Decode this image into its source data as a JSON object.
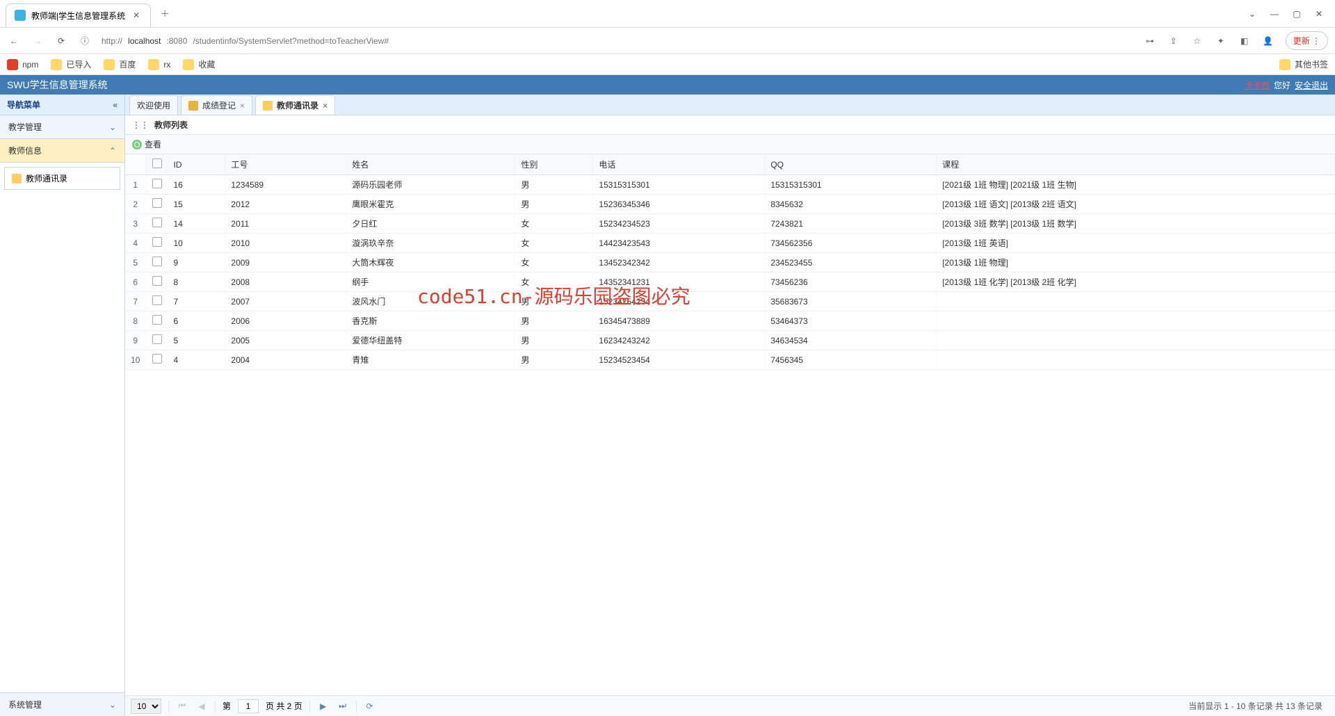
{
  "browser": {
    "tab_title": "教师端|学生信息管理系统",
    "url_prefix": "http://",
    "url_host": "localhost",
    "url_port": ":8080",
    "url_path": "/studentinfo/SystemServlet?method=toTeacherView#",
    "update_label": "更新"
  },
  "bookmarks": {
    "npm": "npm",
    "imported": "已导入",
    "baidu": "百度",
    "rx": "rx",
    "fav": "收藏",
    "other": "其他书签"
  },
  "header": {
    "app_title": "SWU学生信息管理系统",
    "user": "卡卡西",
    "greet": " 您好",
    "logout": "安全退出"
  },
  "sidebar": {
    "title": "导航菜单",
    "sections": {
      "teaching": "教学管理",
      "teacher_info": "教师信息",
      "system": "系统管理"
    },
    "contact": "教师通讯录"
  },
  "tabs": {
    "welcome": "欢迎使用",
    "grades": "成绩登记",
    "contacts": "教师通讯录"
  },
  "panel": {
    "title": "教师列表",
    "view_btn": "查看"
  },
  "columns": {
    "id": "ID",
    "workno": "工号",
    "name": "姓名",
    "sex": "性别",
    "phone": "电话",
    "qq": "QQ",
    "course": "课程"
  },
  "rows": [
    {
      "n": "1",
      "id": "16",
      "workno": "1234589",
      "name": "源码乐园老师",
      "sex": "男",
      "phone": "15315315301",
      "qq": "15315315301",
      "course": "[2021级 1班 物理]    [2021级 1班 生物]"
    },
    {
      "n": "2",
      "id": "15",
      "workno": "2012",
      "name": "鹰眼米霍克",
      "sex": "男",
      "phone": "15236345346",
      "qq": "8345632",
      "course": "[2013级 1班 语文]    [2013级 2班 语文]"
    },
    {
      "n": "3",
      "id": "14",
      "workno": "2011",
      "name": "夕日红",
      "sex": "女",
      "phone": "15234234523",
      "qq": "7243821",
      "course": "[2013级 3班 数学]    [2013级 1班 数学]"
    },
    {
      "n": "4",
      "id": "10",
      "workno": "2010",
      "name": "漩涡玖辛奈",
      "sex": "女",
      "phone": "14423423543",
      "qq": "734562356",
      "course": "[2013级 1班 英语]"
    },
    {
      "n": "5",
      "id": "9",
      "workno": "2009",
      "name": "大筒木辉夜",
      "sex": "女",
      "phone": "13452342342",
      "qq": "234523455",
      "course": "[2013级 1班 物理]"
    },
    {
      "n": "6",
      "id": "8",
      "workno": "2008",
      "name": "纲手",
      "sex": "女",
      "phone": "14352341231",
      "qq": "73456236",
      "course": "[2013级 1班 化学]    [2013级 2班 化学]"
    },
    {
      "n": "7",
      "id": "7",
      "workno": "2007",
      "name": "波风水门",
      "sex": "男",
      "phone": "15234254234",
      "qq": "35683673",
      "course": ""
    },
    {
      "n": "8",
      "id": "6",
      "workno": "2006",
      "name": "香克斯",
      "sex": "男",
      "phone": "16345473889",
      "qq": "53464373",
      "course": ""
    },
    {
      "n": "9",
      "id": "5",
      "workno": "2005",
      "name": "爱德华纽盖特",
      "sex": "男",
      "phone": "16234243242",
      "qq": "34634534",
      "course": ""
    },
    {
      "n": "10",
      "id": "4",
      "workno": "2004",
      "name": "青雉",
      "sex": "男",
      "phone": "15234523454",
      "qq": "7456345",
      "course": ""
    }
  ],
  "pager": {
    "size": "10",
    "page_prefix": "第",
    "page": "1",
    "page_suffix": "页 共 2 页",
    "info": "当前显示 1 - 10 条记录 共 13 条记录"
  },
  "watermark": "code51.cn-源码乐园盗图必究"
}
